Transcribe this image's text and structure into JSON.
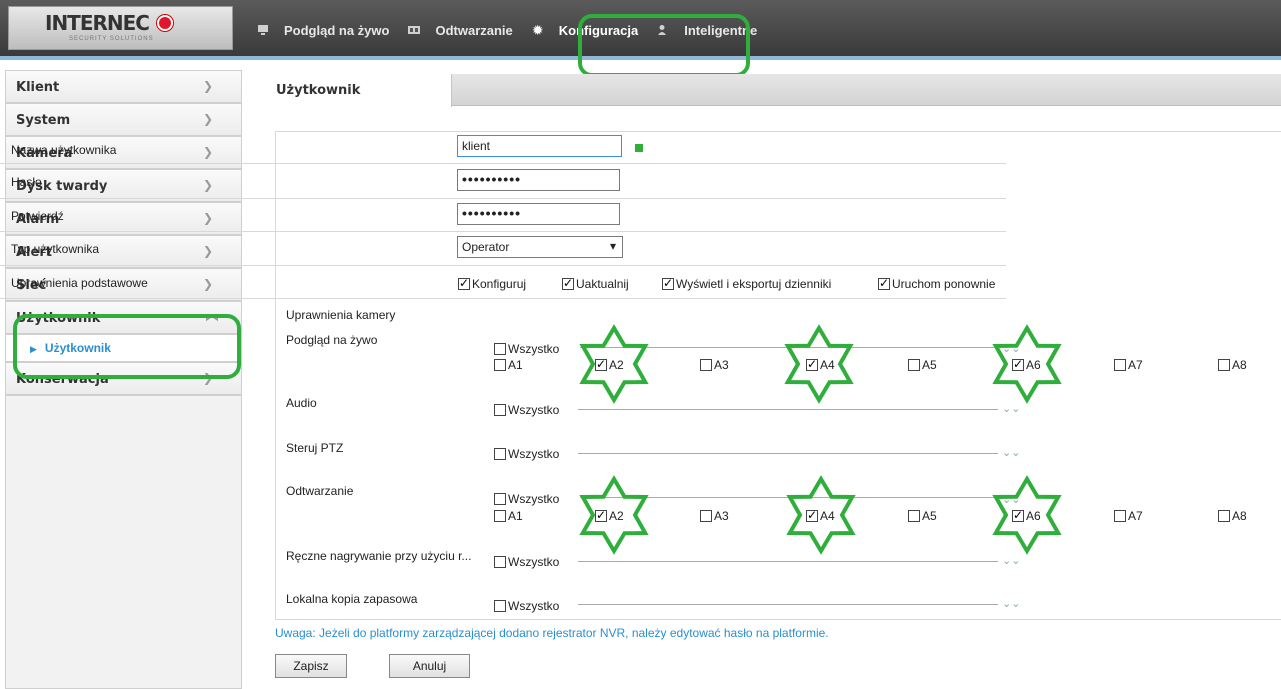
{
  "header": {
    "logo": {
      "text": "INTERNEC",
      "subtitle": "SECURITY SOLUTIONS"
    },
    "nav": [
      {
        "label": "Podgląd na żywo",
        "icon": "monitor-icon"
      },
      {
        "label": "Odtwarzanie",
        "icon": "film-icon"
      },
      {
        "label": "Konfiguracja",
        "icon": "gear-icon"
      },
      {
        "label": "Inteligentne",
        "icon": "person-icon"
      }
    ]
  },
  "sidebar": {
    "items": [
      {
        "label": "Klient"
      },
      {
        "label": "System"
      },
      {
        "label": "Kamera"
      },
      {
        "label": "Dysk twardy"
      },
      {
        "label": "Alarm"
      },
      {
        "label": "Alert"
      },
      {
        "label": "Sieć"
      },
      {
        "label": "Użytkownik",
        "expanded": true,
        "sub": "Użytkownik"
      },
      {
        "label": "Konserwacja"
      }
    ]
  },
  "tab": {
    "label": "Użytkownik"
  },
  "form": {
    "username_label": "Nazwa użytkownika",
    "username_value": "klient",
    "password_label": "Hasło",
    "password_value": "••••••••••",
    "confirm_label": "Potwierdź",
    "confirm_value": "••••••••••",
    "type_label": "Typ użytkownika",
    "type_value": "Operator",
    "basic_perm_label": "Uprawnienia podstawowe",
    "basic_perms": [
      {
        "label": "Konfiguruj",
        "checked": true
      },
      {
        "label": "Uaktualnij",
        "checked": true
      },
      {
        "label": "Wyświetl i eksportuj dzienniki",
        "checked": true
      },
      {
        "label": "Uruchom ponownie",
        "checked": true
      }
    ],
    "camera_perm_label": "Uprawnienia kamery",
    "all_label": "Wszystko",
    "sections": [
      {
        "label": "Podgląd na żywo",
        "channels": [
          {
            "label": "A1",
            "checked": false
          },
          {
            "label": "A2",
            "checked": true
          },
          {
            "label": "A3",
            "checked": false
          },
          {
            "label": "A4",
            "checked": true
          },
          {
            "label": "A5",
            "checked": false
          },
          {
            "label": "A6",
            "checked": true
          },
          {
            "label": "A7",
            "checked": false
          },
          {
            "label": "A8",
            "checked": false
          }
        ]
      },
      {
        "label": "Audio"
      },
      {
        "label": "Steruj PTZ"
      },
      {
        "label": "Odtwarzanie",
        "channels": [
          {
            "label": "A1",
            "checked": false
          },
          {
            "label": "A2",
            "checked": true
          },
          {
            "label": "A3",
            "checked": false
          },
          {
            "label": "A4",
            "checked": true
          },
          {
            "label": "A5",
            "checked": false
          },
          {
            "label": "A6",
            "checked": true
          },
          {
            "label": "A7",
            "checked": false
          },
          {
            "label": "A8",
            "checked": false
          }
        ]
      },
      {
        "label": "Ręczne nagrywanie przy użyciu r..."
      },
      {
        "label": "Lokalna kopia zapasowa"
      }
    ],
    "note": "Uwaga: Jeżeli do platformy zarządzającej dodano rejestrator NVR, należy edytować hasło na platformie.",
    "save_label": "Zapisz",
    "cancel_label": "Anuluj"
  },
  "colors": {
    "highlight": "#2fae3c",
    "accent": "#2a8fd0"
  }
}
